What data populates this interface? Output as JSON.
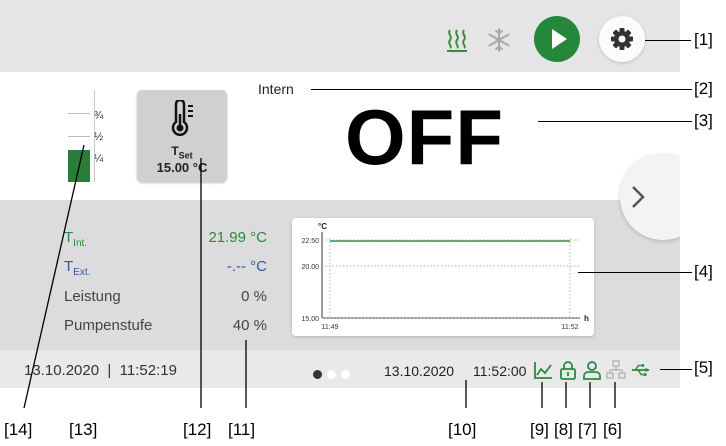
{
  "header": {
    "icons": [
      "heating-icon",
      "cooling-icon",
      "play-icon",
      "gear-icon"
    ],
    "colors": {
      "play_button": "#25873a",
      "heat_icon": "#3c8c3c",
      "cool_icon": "#a8a8a8"
    }
  },
  "level": {
    "labels": [
      "¾",
      "½",
      "¼"
    ],
    "fill_fraction": 0.3,
    "color": "#2a7c3a"
  },
  "setpoint": {
    "icon": "thermometer-icon",
    "label": "T",
    "label_sub": "Set",
    "value": "15.00 °C"
  },
  "mode": "Intern",
  "state": "OFF",
  "values": [
    {
      "label": "T",
      "sub": "Int.",
      "value": "21.99 °C",
      "color": "green"
    },
    {
      "label": "T",
      "sub": "Ext.",
      "value": "-.-- °C",
      "color": "blue"
    },
    {
      "label": "Leistung",
      "sub": "",
      "value": "0 %",
      "color": "gray"
    },
    {
      "label": "Pumpenstufe",
      "sub": "",
      "value": "40 %",
      "color": "gray"
    }
  ],
  "chart_data": {
    "type": "line",
    "ylabel": "°C",
    "xlabel": "h",
    "y_ticks": [
      "22.50",
      "20.00",
      "15.00"
    ],
    "x_ticks": [
      "11:49",
      "11:52"
    ],
    "ylim": [
      15.0,
      22.5
    ],
    "grid": true,
    "series": [
      {
        "values": [
          22.4,
          22.4
        ],
        "color": "#2a8a3d"
      }
    ]
  },
  "status": {
    "datetime": "13.10.2020  |  11:52:19",
    "page_dots": 3,
    "active_page": 0,
    "chart_date": "13.10.2020",
    "chart_time": "11:52:00",
    "icons": [
      "chart-icon",
      "lock-icon",
      "user-icon",
      "network-icon",
      "usb-icon"
    ]
  },
  "callouts": {
    "right": [
      "[1]",
      "[2]",
      "[3]",
      "[4]",
      "[5]"
    ],
    "bottom": [
      "[14]",
      "[13]",
      "[12]",
      "[11]",
      "[10]",
      "[9]",
      "[8]",
      "[7]",
      "[6]"
    ]
  }
}
